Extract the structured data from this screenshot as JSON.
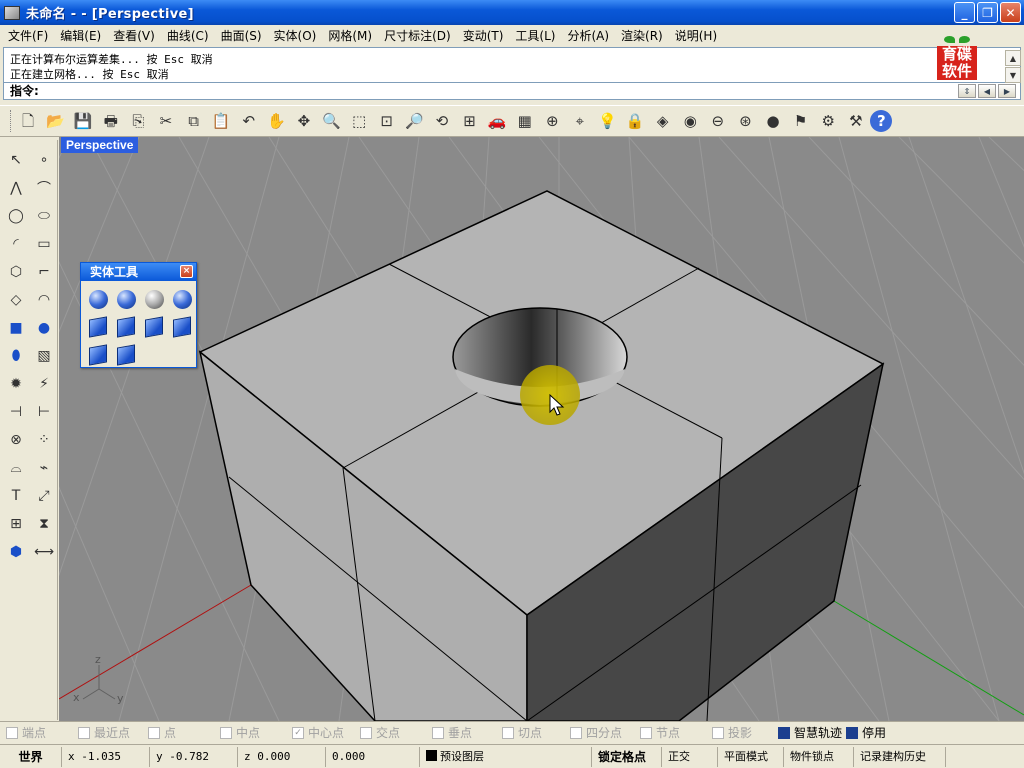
{
  "window": {
    "title": "未命名 - - [Perspective]",
    "buttons": {
      "minimize": "_",
      "restore": "❐",
      "close": "✕"
    }
  },
  "menu": [
    "文件(F)",
    "编辑(E)",
    "查看(V)",
    "曲线(C)",
    "曲面(S)",
    "实体(O)",
    "网格(M)",
    "尺寸标注(D)",
    "变动(T)",
    "工具(L)",
    "分析(A)",
    "渲染(R)",
    "说明(H)"
  ],
  "command_history": [
    "正在计算布尔运算差集... 按 Esc 取消",
    "正在建立网格... 按 Esc 取消"
  ],
  "logo": {
    "text_top": "育碟",
    "text_bottom": "软件"
  },
  "prompt": {
    "label": "指令:",
    "value": ""
  },
  "toolbar_icons": [
    "new-file-icon",
    "open-folder-icon",
    "save-icon",
    "print-icon",
    "import-icon",
    "cut-icon",
    "copy-icon",
    "paste-icon",
    "undo-icon",
    "pan-hand-icon",
    "rotate-view-icon",
    "zoom-dynamic-icon",
    "zoom-window-icon",
    "zoom-extents-icon",
    "zoom-selected-icon",
    "undo-view-icon",
    "four-viewports-icon",
    "car-icon",
    "grid-plane-icon",
    "point-target-icon",
    "snap-icon",
    "light-bulb-icon",
    "lock-icon",
    "layer-icon",
    "color-wheel-icon",
    "wireframe-sphere-icon",
    "shaded-sphere-icon",
    "render-sphere-icon",
    "flag-icon",
    "settings-gear-icon",
    "options-icon",
    "help-icon"
  ],
  "left_palette_icons": [
    "select-arrow-icon",
    "point-icon",
    "polyline-icon",
    "curve-points-icon",
    "circle-icon",
    "ellipse-icon",
    "arc-icon",
    "rectangle-icon",
    "polygon-icon",
    "fillet-curve-icon",
    "surface-from-points-icon",
    "sweep-surface-icon",
    "box-solid-icon",
    "sphere-solid-icon",
    "cylinder-solid-icon",
    "mesh-surface-icon",
    "explode-gear-icon",
    "flame-icon",
    "split-icon",
    "trim-icon",
    "boolean-union-icon",
    "point-cloud-icon",
    "offset-curve-icon",
    "rebuild-curve-icon",
    "text-icon",
    "transform-scale-icon",
    "array-icon",
    "mirror-icon",
    "solid-edit-icon",
    "dimension-icon"
  ],
  "viewport": {
    "label": "Perspective"
  },
  "axis_labels": {
    "x": "x",
    "y": "y",
    "z": "z"
  },
  "solid_tools": {
    "title": "实体工具",
    "close": "×",
    "icons": [
      "boolean-union-icon",
      "boolean-difference-icon",
      "boolean-intersection-icon",
      "boolean-split-icon",
      "extract-surface-icon",
      "cap-holes-icon",
      "merge-faces-icon",
      "solid-box-icon",
      "solid-shell-icon",
      "solid-edge-icon"
    ]
  },
  "osnaps": [
    {
      "label": "端点",
      "checked": false
    },
    {
      "label": "最近点",
      "checked": false
    },
    {
      "label": "点",
      "checked": false
    },
    {
      "label": "中点",
      "checked": false
    },
    {
      "label": "中心点",
      "checked": true
    },
    {
      "label": "交点",
      "checked": false
    },
    {
      "label": "垂点",
      "checked": false
    },
    {
      "label": "切点",
      "checked": false
    },
    {
      "label": "四分点",
      "checked": false
    },
    {
      "label": "节点",
      "checked": false
    },
    {
      "label": "投影",
      "checked": false
    },
    {
      "label": "智慧轨迹",
      "checked": true
    },
    {
      "label": "停用",
      "checked": true
    }
  ],
  "status": {
    "cplane": "世界",
    "x": "x -1.035",
    "y": "y -0.782",
    "z": "z 0.000",
    "distance": "0.000",
    "layer": "预设图层",
    "snap": "锁定格点",
    "ortho": "正交",
    "planar": "平面模式",
    "osnap": "物件锁点",
    "history": "记录建构历史"
  },
  "colors": {
    "titlebar": "#0a58d8",
    "viewport_bg": "#8a8a8a",
    "cursor_highlight": "#c8b400",
    "x_axis": "#b01010",
    "y_axis": "#10a010"
  }
}
